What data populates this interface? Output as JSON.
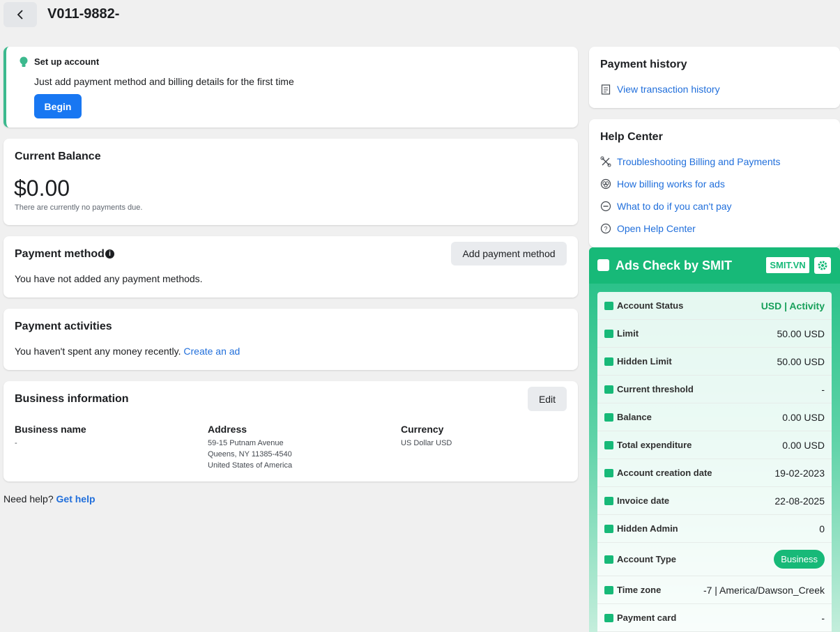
{
  "header": {
    "title": "V011-9882-"
  },
  "setup": {
    "title": "Set up account",
    "description": "Just add payment method and billing details for the first time",
    "button": "Begin"
  },
  "balance": {
    "title": "Current Balance",
    "amount": "$0.00",
    "note": "There are currently no payments due."
  },
  "payment_method": {
    "title": "Payment method",
    "button": "Add payment method",
    "text": "You have not added any payment methods."
  },
  "payment_activities": {
    "title": "Payment activities",
    "text": "You haven't spent any money recently.",
    "link": "Create an ad"
  },
  "business_info": {
    "title": "Business information",
    "edit": "Edit",
    "name_label": "Business name",
    "name_value": "-",
    "address_label": "Address",
    "address_lines": [
      "59-15 Putnam Avenue",
      "Queens, NY 11385-4540",
      "United States of America"
    ],
    "currency_label": "Currency",
    "currency_value": "US Dollar USD"
  },
  "need_help": {
    "text": "Need help?",
    "link": "Get help"
  },
  "payment_history": {
    "title": "Payment history",
    "link": "View transaction history"
  },
  "help_center": {
    "title": "Help Center",
    "links": [
      {
        "label": "Troubleshooting Billing and Payments",
        "icon": "tools-icon"
      },
      {
        "label": "How billing works for ads",
        "icon": "billing-icon"
      },
      {
        "label": "What to do if you can't pay",
        "icon": "minus-circle-icon"
      },
      {
        "label": "Open Help Center",
        "icon": "question-icon"
      }
    ]
  },
  "smit": {
    "title": "Ads Check by SMIT",
    "badge": "SMIT.VN",
    "rows": [
      {
        "label": "Account Status",
        "value": "USD | Activity",
        "style": "green"
      },
      {
        "label": "Limit",
        "value": "50.00 USD"
      },
      {
        "label": "Hidden Limit",
        "value": "50.00 USD"
      },
      {
        "label": "Current threshold",
        "value": "-"
      },
      {
        "label": "Balance",
        "value": "0.00 USD"
      },
      {
        "label": "Total expenditure",
        "value": "0.00 USD"
      },
      {
        "label": "Account creation date",
        "value": "19-02-2023"
      },
      {
        "label": "Invoice date",
        "value": "22-08-2025"
      },
      {
        "label": "Hidden Admin",
        "value": "0"
      },
      {
        "label": "Account Type",
        "value": "Business",
        "style": "pill"
      },
      {
        "label": "Time zone",
        "value": "-7 | America/Dawson_Creek"
      },
      {
        "label": "Payment card",
        "value": "-"
      }
    ]
  },
  "colors": {
    "accent": "#1877f2",
    "link": "#216fdb",
    "smit_green": "#17b978"
  }
}
